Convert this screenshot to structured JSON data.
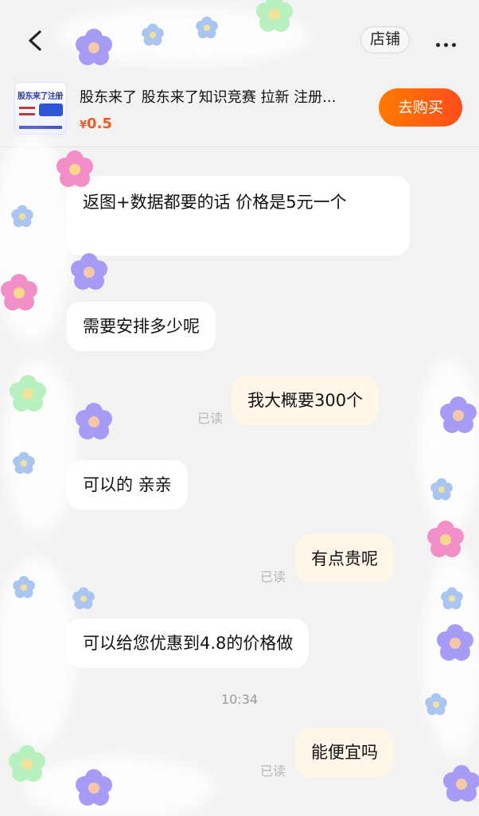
{
  "header": {
    "back_icon": "chevron-left-icon",
    "shop_label": "店铺",
    "more_icon": "more-dots-icon"
  },
  "product": {
    "thumb_text": "股东来了注册",
    "title": "股东来了 股东来了知识竞赛 拉新 注册...",
    "currency": "¥",
    "price": "0.5",
    "buy_label": "去购买",
    "colors": {
      "price": "#f05a28",
      "buy_start": "#ff7a00",
      "buy_end": "#ff4d1a"
    }
  },
  "messages": [
    {
      "side": "in",
      "text": "返图+数据都要的话 价格是5元一个"
    },
    {
      "side": "in",
      "text": "需要安排多少呢"
    },
    {
      "side": "out",
      "text": "我大概要300个",
      "status": "已读"
    },
    {
      "side": "in",
      "text": "可以的 亲亲"
    },
    {
      "side": "out",
      "text": "有点贵呢",
      "status": "已读"
    },
    {
      "side": "in",
      "text": "可以给您优惠到4.8的价格做"
    },
    {
      "side": "out",
      "text": "能便宜吗",
      "status": "已读"
    }
  ],
  "timestamp": "10:34"
}
